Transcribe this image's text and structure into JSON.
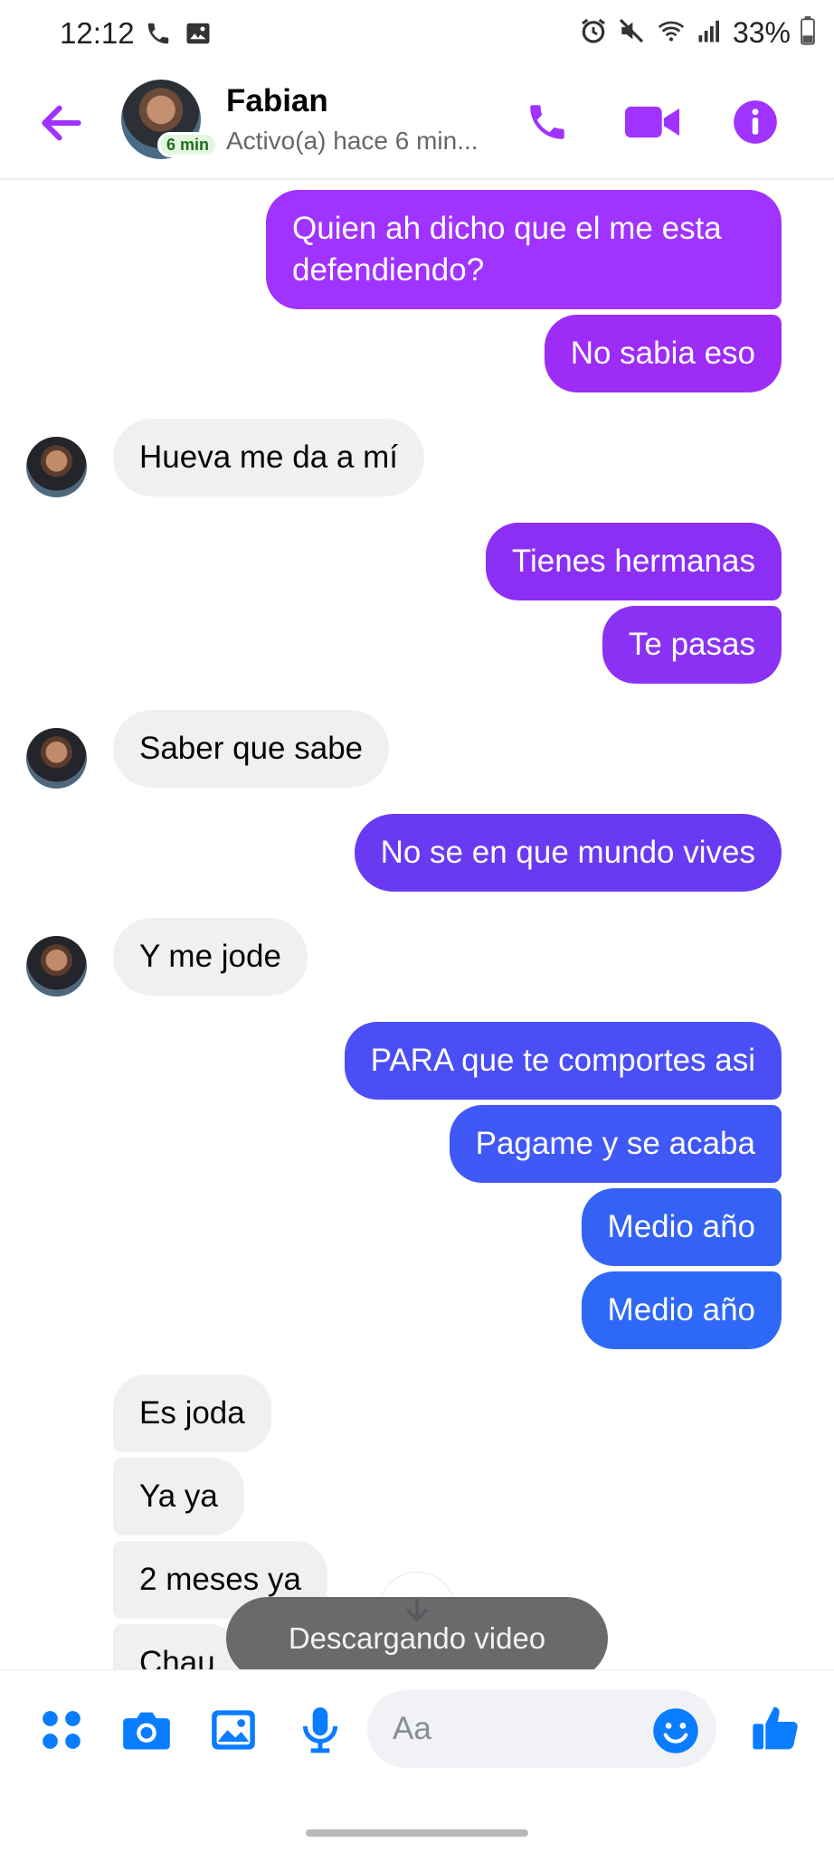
{
  "status_bar": {
    "time": "12:12",
    "battery": "33%",
    "icons": [
      "phone-call-icon",
      "image-icon",
      "alarm-icon",
      "mute-icon",
      "wifi-icon",
      "signal-icon",
      "battery-icon"
    ]
  },
  "header": {
    "contact_name": "Fabian",
    "status": "Activo(a) hace 6 min...",
    "active_badge": "6 min",
    "accent": "#a033ff"
  },
  "messages": [
    {
      "dir": "out",
      "text": "Quien ah dicho que el me esta defendiendo?",
      "color": "#a033ff"
    },
    {
      "dir": "out",
      "text": "No sabia eso",
      "color": "#9d2cf7"
    },
    {
      "dir": "in",
      "text": "Hueva me da a mí",
      "avatar": true
    },
    {
      "dir": "out",
      "text": "Tienes hermanas",
      "color": "#8c2ff5"
    },
    {
      "dir": "out",
      "text": "Te pasas",
      "color": "#8a31f3"
    },
    {
      "dir": "in",
      "text": "Saber que sabe",
      "avatar": true
    },
    {
      "dir": "out",
      "text": "No se en que mundo vives",
      "color": "#6a3af2"
    },
    {
      "dir": "in",
      "text": "Y me jode",
      "avatar": true
    },
    {
      "dir": "out",
      "text": "PARA que te comportes asi",
      "color": "#4b4ef5"
    },
    {
      "dir": "out",
      "text": "Pagame y se acaba",
      "color": "#3f58f6"
    },
    {
      "dir": "out",
      "text": "Medio año",
      "color": "#3462f5"
    },
    {
      "dir": "out",
      "text": "Medio año",
      "color": "#2e68f6"
    },
    {
      "dir": "in",
      "text": "Es joda"
    },
    {
      "dir": "in",
      "text": "Ya ya"
    },
    {
      "dir": "in",
      "text": "2 meses ya"
    },
    {
      "dir": "in",
      "text": "Chau"
    }
  ],
  "toast": "Descargando video",
  "composer": {
    "placeholder": "Aa",
    "icon_color": "#0a7cff"
  }
}
